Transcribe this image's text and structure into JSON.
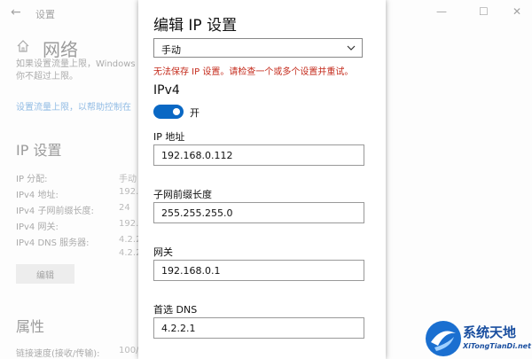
{
  "window": {
    "back_glyph": "←",
    "title": "设置",
    "minimize": "—",
    "maximize": "☐",
    "close": "✕"
  },
  "background": {
    "page_title": "网络",
    "note_line1": "如果设置流量上限，Windows",
    "note_line2": "你不超过上限。",
    "link": "设置流量上限，以帮助控制在",
    "ip_heading": "IP 设置",
    "rows": [
      {
        "label": "IP 分配:",
        "value": "手动"
      },
      {
        "label": "IPv4 地址:",
        "value": "192."
      },
      {
        "label": "IPv4 子网前缀长度:",
        "value": "24"
      },
      {
        "label": "IPv4 网关:",
        "value": "192."
      },
      {
        "label": "IPv4 DNS 服务器:",
        "value": "4.2.2"
      }
    ],
    "dns_extra": "4.2.2",
    "edit_button": "编辑",
    "props_heading": "属性",
    "speed_label": "链接速度(接收/传输):",
    "speed_value": "100/"
  },
  "dialog": {
    "title": "编辑 IP 设置",
    "mode_selected": "手动",
    "error": "无法保存 IP 设置。请检查一个或多个设置并重试。",
    "ipv4_heading": "IPv4",
    "toggle_label": "开",
    "toggle_on": true,
    "fields": [
      {
        "label": "IP 地址",
        "value": "192.168.0.112"
      },
      {
        "label": "子网前缀长度",
        "value": "255.255.255.0"
      },
      {
        "label": "网关",
        "value": "192.168.0.1"
      },
      {
        "label": "首选 DNS",
        "value": "4.2.2.1"
      }
    ]
  },
  "watermark": {
    "name": "系统天地",
    "url": "XiTongTianDi.net"
  },
  "colors": {
    "accent": "#0a68c4",
    "error": "#c42b1c",
    "watermark": "#1a4fa0"
  }
}
